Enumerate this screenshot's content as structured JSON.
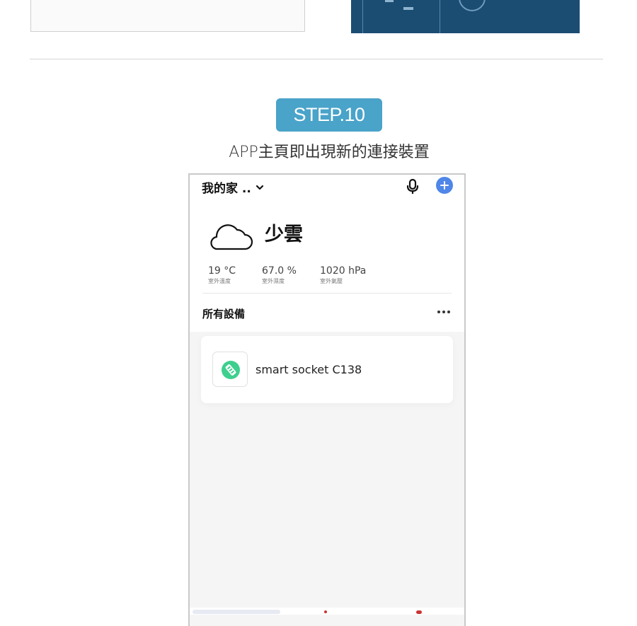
{
  "step": {
    "label": "STEP.10"
  },
  "caption": "APP主頁即出現新的連接裝置",
  "app": {
    "home_name": "我的家 ..",
    "weather": {
      "condition": "少雲",
      "stats": [
        {
          "value": "19 °C",
          "label": "室外溫度"
        },
        {
          "value": "67.0 %",
          "label": "室外濕度"
        },
        {
          "value": "1020 hPa",
          "label": "室外氣壓"
        }
      ]
    },
    "section_title": "所有設備",
    "devices": [
      {
        "name": "smart socket C138",
        "icon": "smart-socket-icon"
      }
    ]
  },
  "colors": {
    "step_badge": "#4aa3c9",
    "add_button": "#4f86e8",
    "device_icon": "#3ecf8e",
    "preview_panel": "#1b4d73"
  },
  "icons": [
    "chevron-down-icon",
    "microphone-icon",
    "add-icon",
    "cloud-icon",
    "more-icon",
    "smart-socket-icon"
  ]
}
